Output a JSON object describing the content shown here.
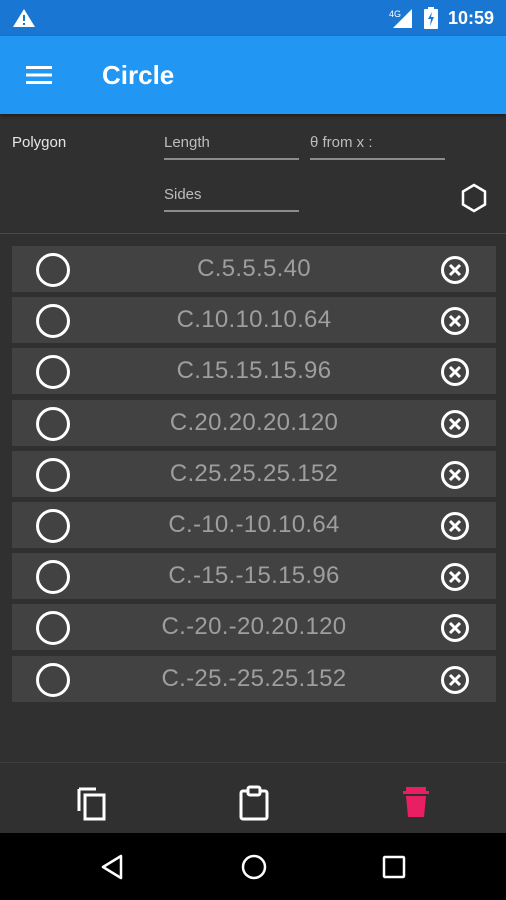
{
  "status_bar": {
    "time": "10:59",
    "icons": [
      "warning-icon",
      "signal-icon",
      "battery-icon"
    ]
  },
  "app_bar": {
    "title": "Circle",
    "menu_icon": "hamburger-menu-icon",
    "color": "#2196F3",
    "status_color": "#1976D2"
  },
  "form": {
    "label": "Polygon",
    "length_placeholder": "Length",
    "theta_placeholder": "θ from x :",
    "sides_placeholder": "Sides",
    "action_icon": "hexagon-icon"
  },
  "items": [
    {
      "label": "C.5.5.5.40"
    },
    {
      "label": "C.10.10.10.64"
    },
    {
      "label": "C.15.15.15.96"
    },
    {
      "label": "C.20.20.20.120"
    },
    {
      "label": "C.25.25.25.152"
    },
    {
      "label": "C.-10.-10.10.64"
    },
    {
      "label": "C.-15.-15.15.96"
    },
    {
      "label": "C.-20.-20.20.120"
    },
    {
      "label": "C.-25.-25.25.152"
    }
  ],
  "bottom_actions": {
    "icons": [
      "copy-icon",
      "paste-icon",
      "delete-icon"
    ],
    "delete_color": "#E91E63"
  },
  "nav_bar": {
    "icons": [
      "back-icon",
      "home-icon",
      "recents-icon"
    ]
  }
}
